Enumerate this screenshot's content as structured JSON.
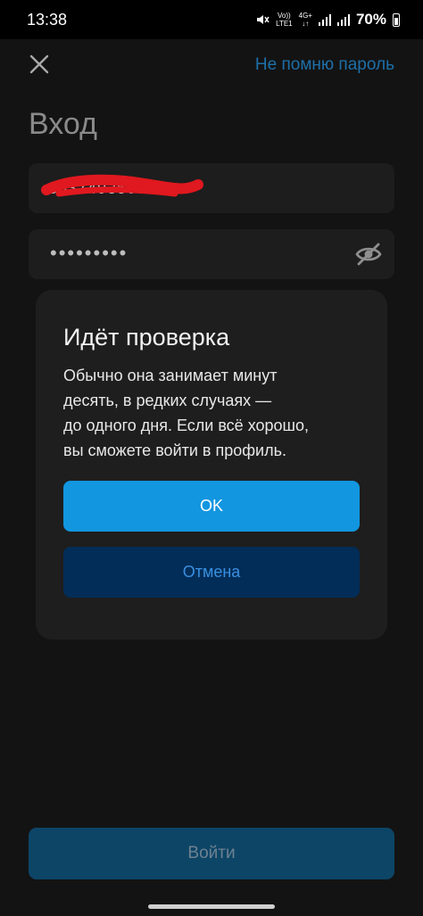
{
  "status_bar": {
    "time": "13:38",
    "volte_top": "Vo))",
    "volte_bottom": "LTE1",
    "network_top": "4G+",
    "network_bottom": "↓↑",
    "battery_percent": "70%"
  },
  "header": {
    "close_icon": "close-icon",
    "forgot_link": "Не помню пароль"
  },
  "page": {
    "title": "Вход"
  },
  "form": {
    "login_value": "89374935050",
    "password_mask": "•••••••••",
    "eye_icon": "eye-off-icon",
    "submit_label": "Войти"
  },
  "modal": {
    "title": "Идёт проверка",
    "text_lines": [
      "Обычно она занимает минут",
      "десять, в редких случаях —",
      "до одного дня. Если всё хорошо,",
      "вы сможете войти в профиль."
    ],
    "ok_label": "OK",
    "cancel_label": "Отмена"
  },
  "colors": {
    "accent": "#1296e0",
    "link": "#1e6fa8",
    "cancel_bg": "#022d58",
    "background": "#131313",
    "redaction": "#e0181f"
  }
}
